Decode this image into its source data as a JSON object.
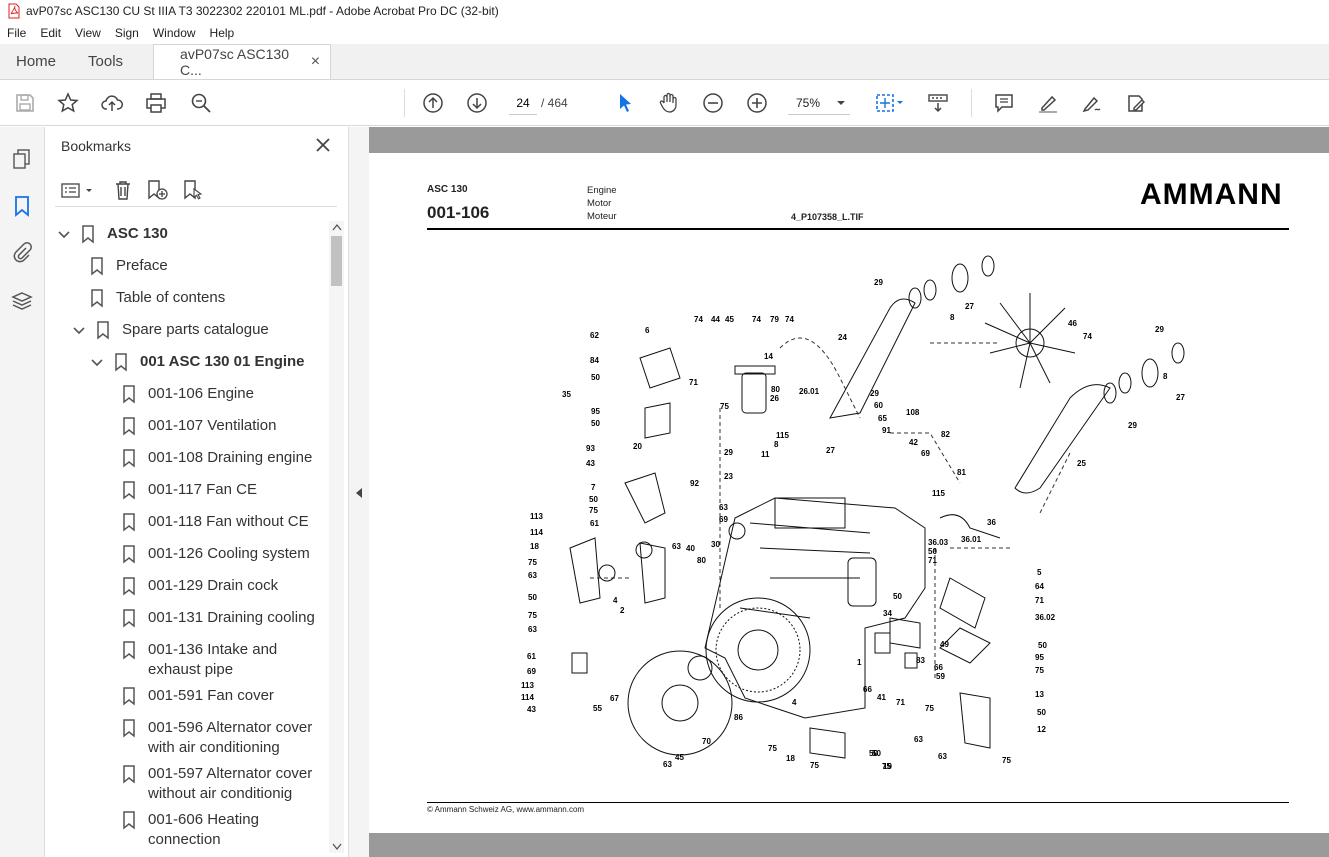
{
  "window": {
    "title": "avP07sc ASC130 CU St IIIA T3 3022302 220101 ML.pdf - Adobe Acrobat Pro DC (32-bit)"
  },
  "menu": [
    "File",
    "Edit",
    "View",
    "Sign",
    "Window",
    "Help"
  ],
  "tabs": {
    "home": "Home",
    "tools": "Tools",
    "document": "avP07sc ASC130 C...",
    "close": "×"
  },
  "toolbar": {
    "page_current": "24",
    "page_total": "/ 464",
    "zoom": "75%"
  },
  "bookmarks": {
    "title": "Bookmarks",
    "items": [
      {
        "label": "ASC 130"
      },
      {
        "label": "Preface"
      },
      {
        "label": "Table of contens"
      },
      {
        "label": "Spare parts catalogue"
      },
      {
        "label": "001 ASC 130 01 Engine"
      },
      {
        "label": "001-106 Engine"
      },
      {
        "label": "001-107 Ventilation"
      },
      {
        "label": "001-108 Draining engine"
      },
      {
        "label": "001-117 Fan CE"
      },
      {
        "label": "001-118 Fan without CE"
      },
      {
        "label": "001-126 Cooling system"
      },
      {
        "label": "001-129 Drain cock"
      },
      {
        "label": "001-131 Draining cooling"
      },
      {
        "label": "001-136 Intake and exhaust pipe"
      },
      {
        "label": "001-591 Fan cover"
      },
      {
        "label": "001-596 Alternator cover with air conditioning"
      },
      {
        "label": "001-597 Alternator cover without air conditionig"
      },
      {
        "label": "001-606 Heating connection"
      }
    ]
  },
  "document": {
    "model": "ASC 130",
    "code": "001-106",
    "lang1": "Engine",
    "lang2": "Motor",
    "lang3": "Moteur",
    "image_ref": "4_P107358_L.TIF",
    "brand": "AMMANN",
    "footer": "© Ammann Schweiz AG, www.ammann.com",
    "callouts": [
      "29",
      "8",
      "27",
      "46",
      "74",
      "29",
      "8",
      "27",
      "25",
      "29",
      "24",
      "6",
      "74",
      "44",
      "45",
      "74",
      "79",
      "74",
      "62",
      "84",
      "50",
      "71",
      "14",
      "35",
      "95",
      "50",
      "75",
      "80",
      "26",
      "26.01",
      "29",
      "60",
      "65",
      "108",
      "82",
      "91",
      "42",
      "115",
      "8",
      "27",
      "11",
      "29",
      "93",
      "43",
      "20",
      "69",
      "81",
      "92",
      "23",
      "115",
      "7",
      "50",
      "75",
      "63",
      "69",
      "61",
      "113",
      "114",
      "40",
      "30",
      "36",
      "36.01",
      "36.03",
      "50",
      "71",
      "18",
      "75",
      "63",
      "50",
      "75",
      "63",
      "63",
      "4",
      "2",
      "80",
      "5",
      "64",
      "71",
      "36.02",
      "50",
      "34",
      "49",
      "83",
      "66",
      "59",
      "50",
      "95",
      "75",
      "13",
      "61",
      "69",
      "113",
      "114",
      "43",
      "67",
      "55",
      "1",
      "66",
      "41",
      "71",
      "63",
      "75",
      "86",
      "4",
      "50",
      "75",
      "50",
      "12",
      "70",
      "45",
      "63",
      "75",
      "18",
      "75",
      "50",
      "19",
      "75",
      "63"
    ]
  }
}
